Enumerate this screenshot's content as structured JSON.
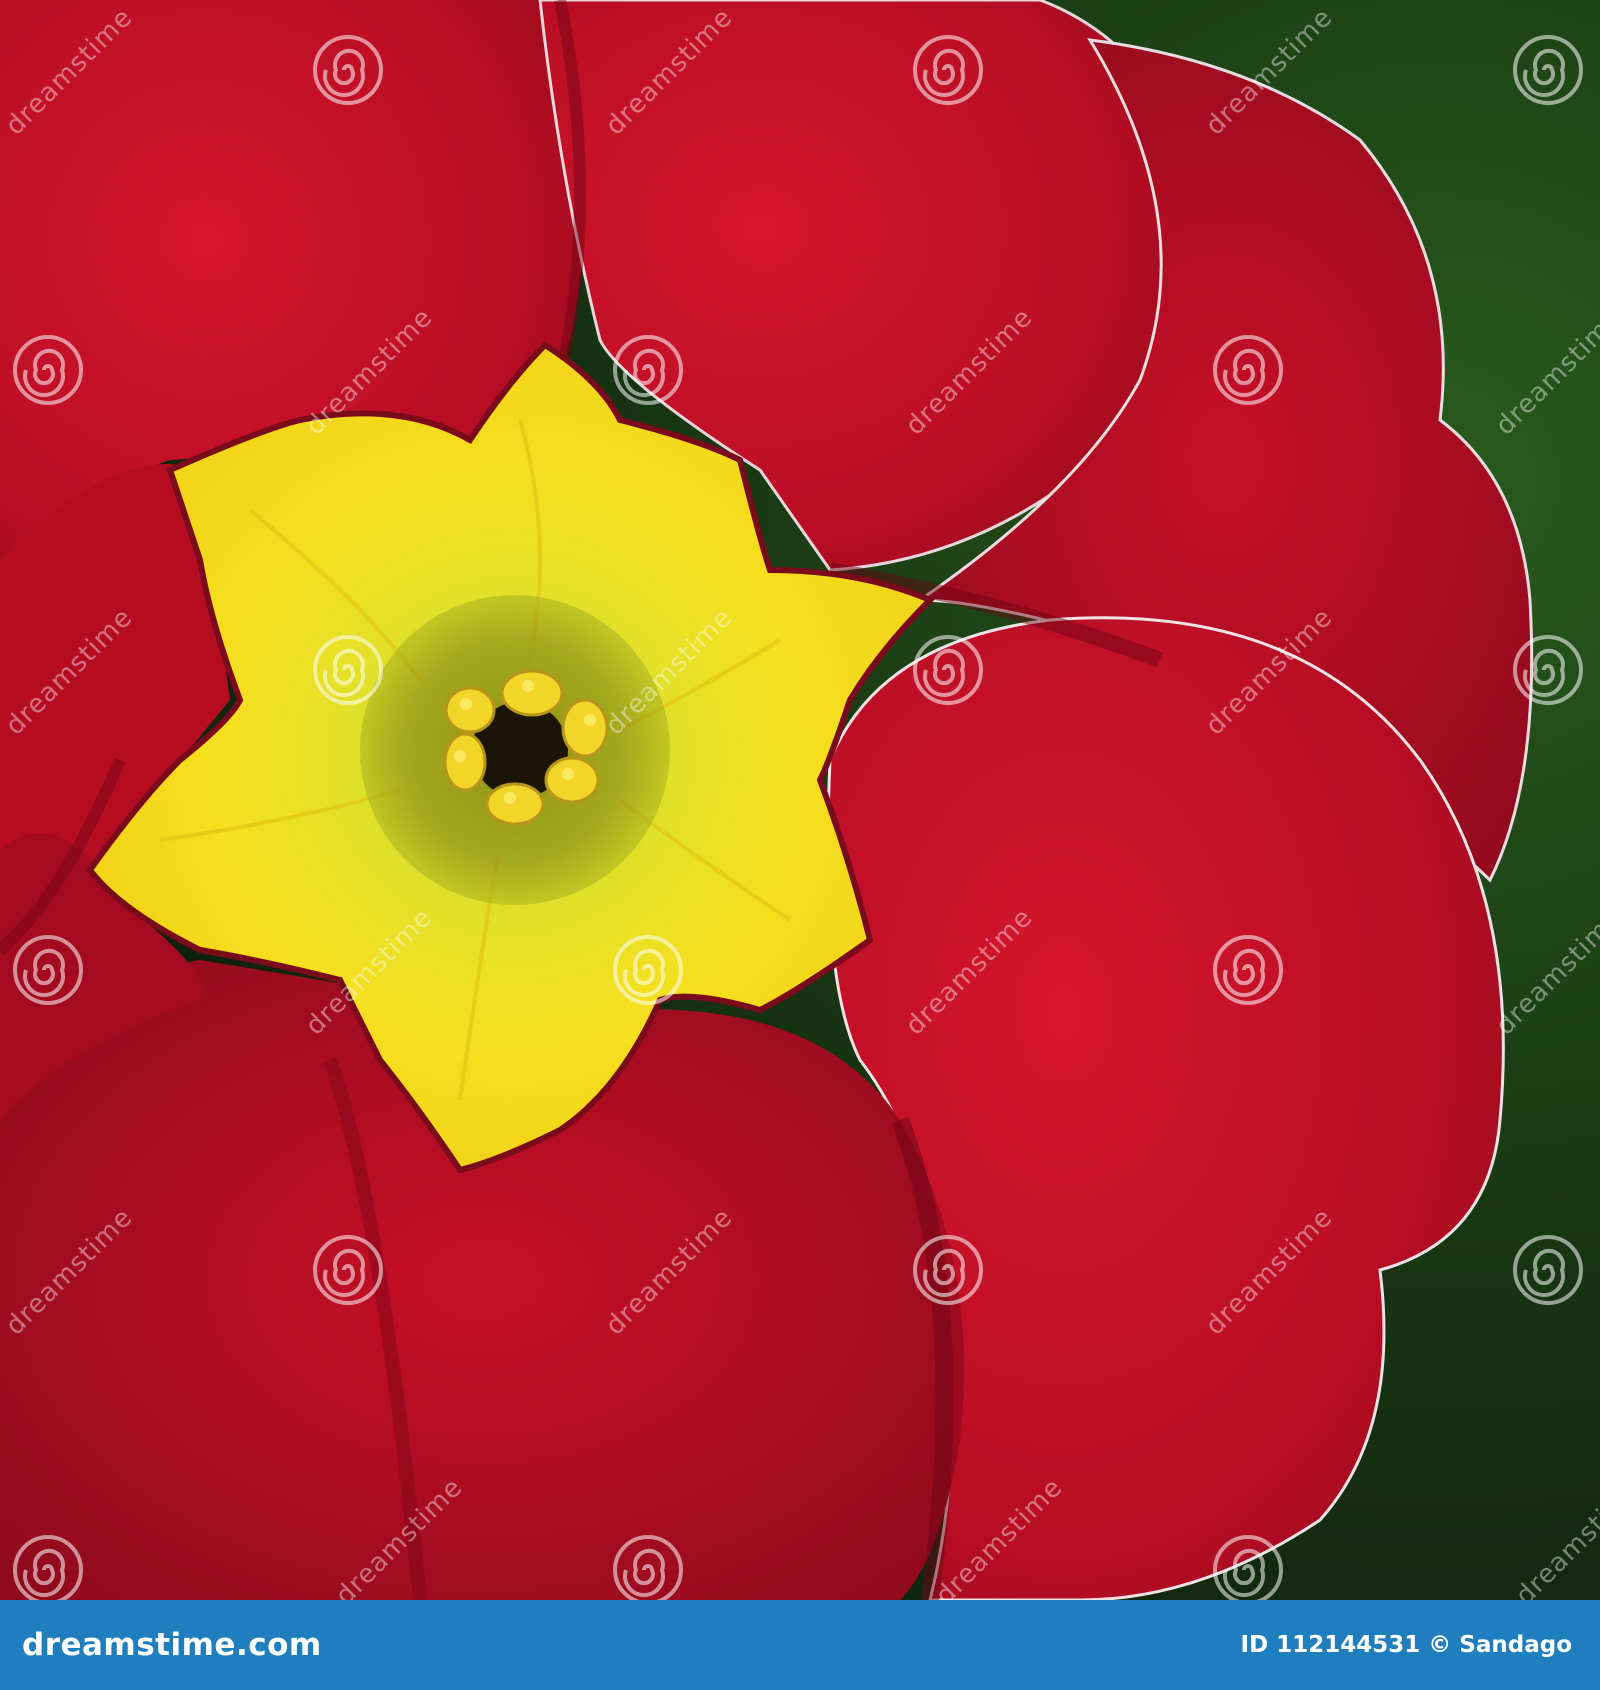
{
  "image": {
    "subject": "primrose-flower",
    "colors": {
      "petal": "#c4102a",
      "petal_dark": "#6e0716",
      "eye": "#f4d81c",
      "throat": "#b9c61c",
      "background": "#1c3d14"
    }
  },
  "watermark": {
    "word": "dreamstime",
    "icon": "spiral-icon"
  },
  "footer": {
    "logo": "dreamstime.com",
    "id_label": "ID",
    "id_value": "112144531",
    "copyright": "©",
    "author": "Sandago"
  }
}
